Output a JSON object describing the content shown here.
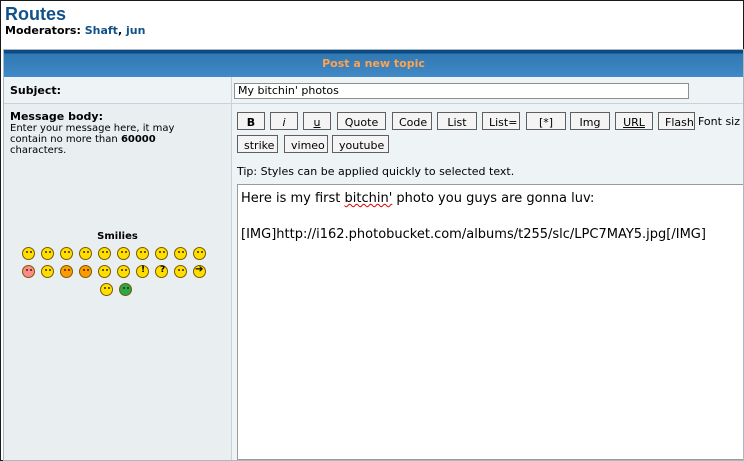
{
  "forum": {
    "title": "Routes",
    "moderators_label": "Moderators:",
    "moderators": [
      "Shaft",
      "jun"
    ]
  },
  "form": {
    "header_title": "Post a new topic",
    "subject_label": "Subject:",
    "subject_value": "My bitchin' photos",
    "message_body_label": "Message body:",
    "message_help_prefix": "Enter your message here, it may contain no more than",
    "message_char_limit": "60000",
    "message_help_suffix": "characters.",
    "smilies_title": "Smilies"
  },
  "toolbar": {
    "buttons_row1": [
      "B",
      "i",
      "u",
      "Quote",
      "Code",
      "List",
      "List=",
      "[*]",
      "Img",
      "URL",
      "Flash"
    ],
    "buttons_row2": [
      "strike",
      "vimeo",
      "youtube"
    ],
    "font_size_label": "Font siz",
    "tip": "Tip: Styles can be applied quickly to selected text."
  },
  "message": {
    "line1_prefix": "Here is my first ",
    "line1_misspelled": "bitchin'",
    "line1_suffix": " photo you guys are gonna luv:",
    "line2": "[IMG]http://i162.photobucket.com/albums/t255/slc/LPC7MAY5.jpg[/IMG]"
  },
  "smilies": [
    "very-happy-icon",
    "smile-icon",
    "sad-icon",
    "surprised-icon",
    "shocked-icon",
    "confused-icon",
    "cool-icon",
    "laughing-icon",
    "mad-icon",
    "razz-icon",
    "embarrassed-icon",
    "crying-icon",
    "evil-icon",
    "twisted-evil-icon",
    "rolling-eyes-icon",
    "wink-icon",
    "exclamation-icon",
    "question-icon",
    "idea-icon",
    "arrow-icon",
    "neutral-icon",
    "mr-green-icon"
  ],
  "colors": {
    "title": "#105289",
    "header_text": "#ffa34f",
    "header_bar": "#4189c7",
    "panel_bg": "#e9eef1",
    "misspelling": "#e00000"
  }
}
